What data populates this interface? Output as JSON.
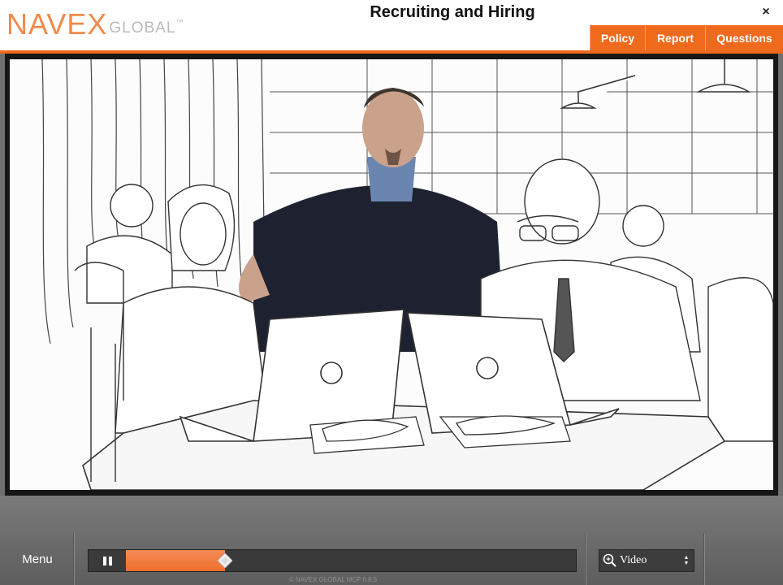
{
  "header": {
    "logo_main": "NAVEX",
    "logo_sub": "GLOBAL",
    "logo_tm": "™",
    "title": "Recruiting and Hiring",
    "close_icon": "×",
    "tabs": [
      {
        "label": "Policy"
      },
      {
        "label": "Report"
      },
      {
        "label": "Questions"
      }
    ]
  },
  "controls": {
    "menu_label": "Menu",
    "progress_fraction": 0.22,
    "view_select": {
      "selected": "Video",
      "icon": "search-zoom-icon"
    }
  },
  "footer": {
    "copyright": "© NAVEX GLOBAL MCP 6.8.5"
  },
  "colors": {
    "accent": "#ef6a1d",
    "logo_orange": "#f08a4b",
    "logo_gray": "#b9b9b9"
  }
}
